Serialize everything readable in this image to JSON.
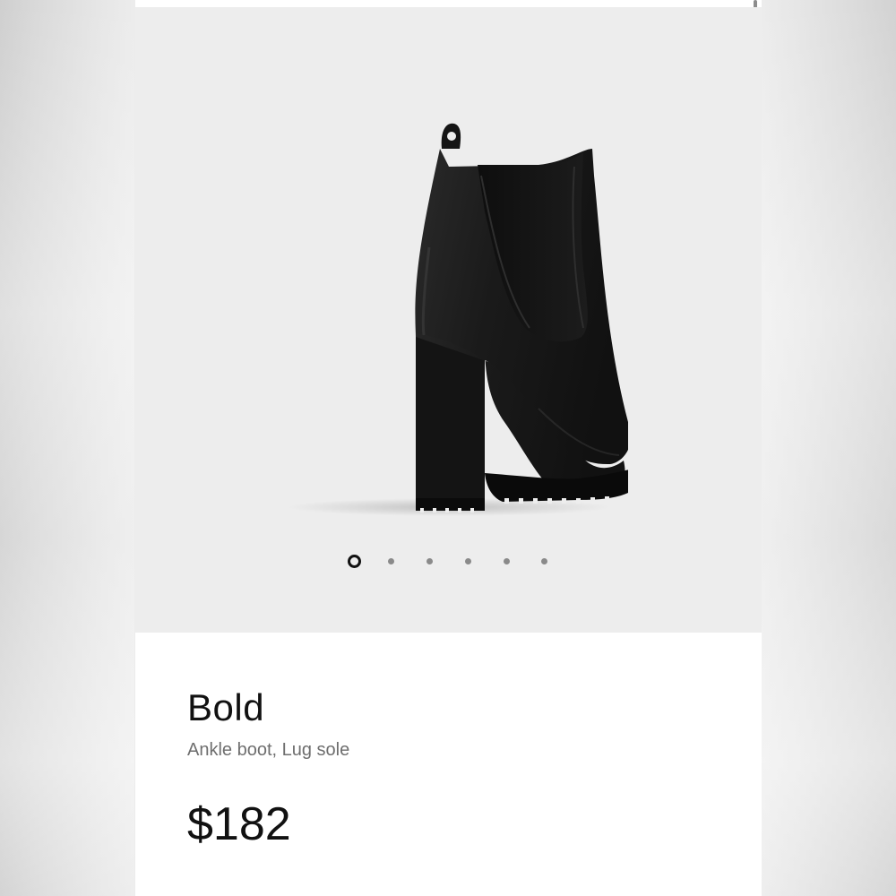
{
  "product": {
    "name": "Bold",
    "description": "Ankle boot, Lug sole",
    "price": "$182",
    "image_icon": "ankle-boot-image"
  },
  "gallery": {
    "total_images": 6,
    "active_index": 0
  },
  "colors": {
    "gallery_background": "#ededed",
    "text_primary": "#111111",
    "text_secondary": "#6e6e6e",
    "dot_inactive": "#8a8a8a"
  }
}
